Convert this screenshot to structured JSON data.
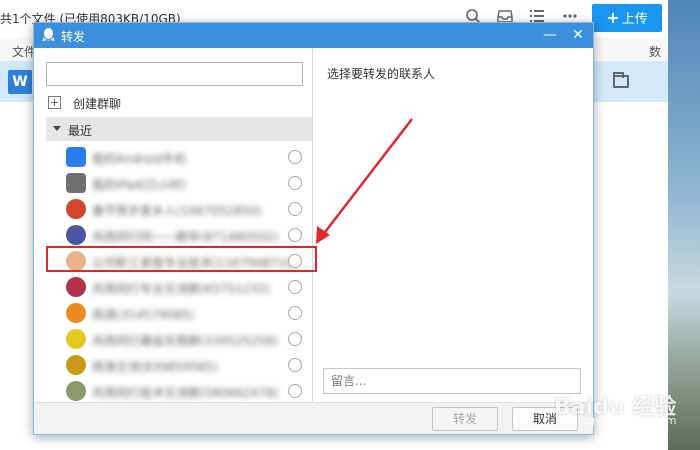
{
  "background": {
    "title": "共1个文件 (已使用803KB/10GB)",
    "upload_button": "上传",
    "column_file": "文件",
    "column_count": "数",
    "file_icon_letter": "W",
    "icons": [
      "search-icon",
      "inbox-icon",
      "list-view-icon",
      "more-icon"
    ]
  },
  "dialog": {
    "title": "转发",
    "minimize": "—",
    "close": "✕",
    "search_placeholder": "",
    "create_group": "创建群聊",
    "section_recent": "最近",
    "hint": "选择要转发的联系人",
    "message_placeholder": "留言...",
    "forward_button": "转发",
    "cancel_button": "取消",
    "contacts": [
      {
        "name": "我的Android手机",
        "avatar": "phone-icon",
        "color": "#2b7de9",
        "highlighted": false
      },
      {
        "name": "我的iPad(已小时)",
        "avatar": "tablet-icon",
        "color": "#707070",
        "highlighted": false
      },
      {
        "name": "春节贺岁家乡人(1067052850)",
        "avatar": "avatar-icon",
        "color": "#d3452e",
        "highlighted": false
      },
      {
        "name": "风雨同行同一一群年(871480502)",
        "avatar": "avatar-icon",
        "color": "#4b55a3",
        "highlighted": false
      },
      {
        "name": "公司职工家庭专业技术(1167948710)",
        "avatar": "avatar-icon",
        "color": "#e8b28a",
        "highlighted": true
      },
      {
        "name": "风雨同行专业交流群(65751232)",
        "avatar": "avatar-icon",
        "color": "#b1304a",
        "highlighted": false
      },
      {
        "name": "雨滴(314579085)",
        "avatar": "avatar-icon",
        "color": "#e98b1f",
        "highlighted": false
      },
      {
        "name": "风雨同行邂逅无限群(339525258)",
        "avatar": "avatar-icon",
        "color": "#e5c820",
        "highlighted": false
      },
      {
        "name": "雨滴交流(839859565)",
        "avatar": "avatar-icon",
        "color": "#c79a1a",
        "highlighted": false
      },
      {
        "name": "风雨同行技术交流群(580662478)",
        "avatar": "avatar-icon",
        "color": "#8a9a6a",
        "highlighted": false
      }
    ]
  },
  "watermark": {
    "text": "Baidu 经验",
    "sub": "jingyan.baidu.com"
  },
  "colors": {
    "titlebar": "#3d8fdb",
    "upload_button": "#1a95f0",
    "selected_row": "#d4e8fb",
    "annotation_red": "#e0262b"
  }
}
